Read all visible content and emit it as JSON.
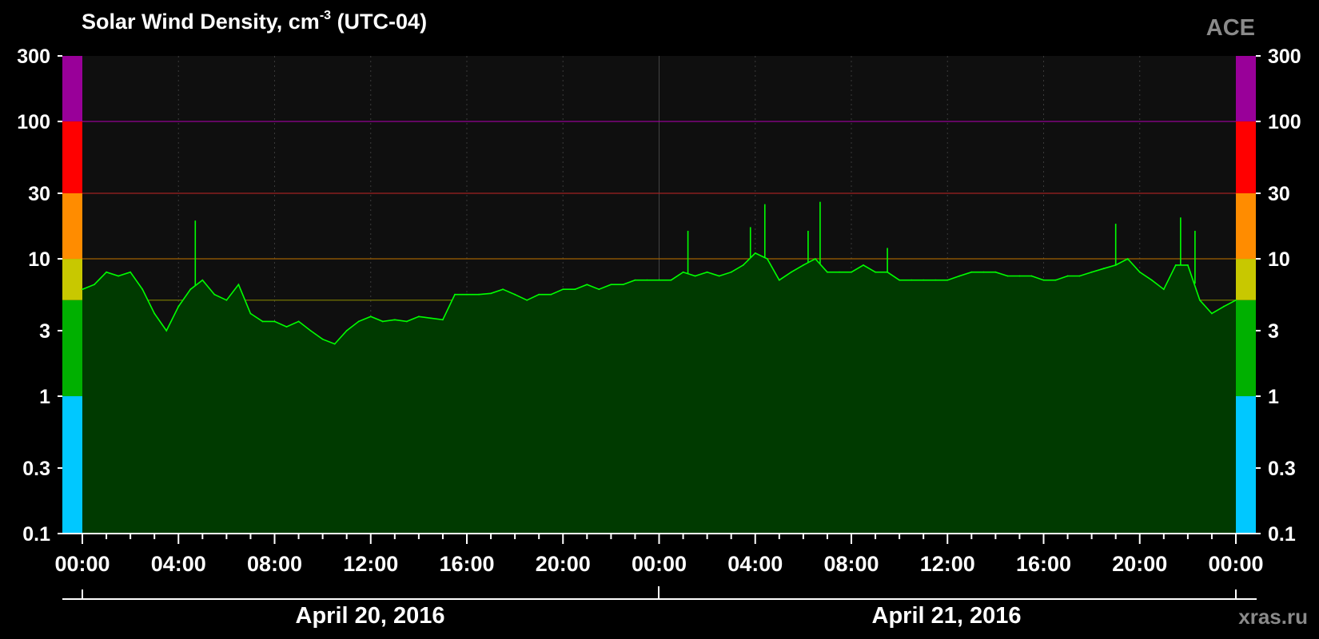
{
  "title": {
    "text": "Solar Wind Density, cm",
    "superscript": "-3",
    "suffix": " (UTC-04)"
  },
  "source_label": "ACE",
  "watermark": "xras.ru",
  "colors": {
    "line": "#00ff00",
    "fill": "#003a00",
    "plot_bg": "#0f0f0f",
    "band_purple": "#990099",
    "band_red": "#ff0000",
    "band_orange": "#ff8c00",
    "band_yellow": "#c8c800",
    "band_green": "#00b000",
    "band_cyan": "#00c8ff"
  },
  "chart_data": {
    "type": "area",
    "yscale": "log",
    "ylim": [
      0.1,
      300
    ],
    "y_ticks": [
      "0.1",
      "0.3",
      "1",
      "3",
      "10",
      "30",
      "100",
      "300"
    ],
    "x_range_hours": [
      0,
      48
    ],
    "x_tick_labels": [
      "00:00",
      "04:00",
      "08:00",
      "12:00",
      "16:00",
      "20:00",
      "00:00",
      "04:00",
      "08:00",
      "12:00",
      "16:00",
      "20:00",
      "00:00"
    ],
    "date_labels": [
      "April 20, 2016",
      "April 21, 2016"
    ],
    "threshold_lines": [
      {
        "value": 100,
        "color": "#a000a0"
      },
      {
        "value": 30,
        "color": "#a02020"
      },
      {
        "value": 10,
        "color": "#a06000"
      },
      {
        "value": 5,
        "color": "#808000"
      }
    ],
    "color_bands": [
      {
        "from": 100,
        "to": 300,
        "color": "#990099"
      },
      {
        "from": 30,
        "to": 100,
        "color": "#ff0000"
      },
      {
        "from": 10,
        "to": 30,
        "color": "#ff8c00"
      },
      {
        "from": 5,
        "to": 10,
        "color": "#c8c800"
      },
      {
        "from": 1,
        "to": 5,
        "color": "#00b000"
      },
      {
        "from": 0.1,
        "to": 1,
        "color": "#00c8ff"
      }
    ],
    "series": [
      {
        "x": [
          0,
          0.5,
          1,
          1.5,
          2,
          2.5,
          3,
          3.5,
          4,
          4.5,
          5,
          5.5,
          6,
          6.5,
          7,
          7.5,
          8,
          8.5,
          9,
          9.5,
          10,
          10.5,
          11,
          11.5,
          12,
          12.5,
          13,
          13.5,
          14,
          14.5,
          15,
          15.5,
          16,
          16.5,
          17,
          17.5,
          18,
          18.5,
          19,
          19.5,
          20,
          20.5,
          21,
          21.5,
          22,
          22.5,
          23,
          23.5,
          24,
          24.5,
          25,
          25.5,
          26,
          26.5,
          27,
          27.5,
          28,
          28.5,
          29,
          29.5,
          30,
          30.5,
          31,
          31.5,
          32,
          32.5,
          33,
          33.5,
          34,
          34.5,
          35,
          35.5,
          36,
          36.5,
          37,
          37.5,
          38,
          38.5,
          39,
          39.5,
          40,
          40.5,
          41,
          41.5,
          42,
          42.5,
          43,
          43.5,
          44,
          44.5,
          45,
          45.5,
          46,
          46.5,
          47,
          47.5,
          48
        ],
        "values": [
          6,
          6.5,
          8,
          7.5,
          8,
          6,
          4,
          3,
          4.5,
          6,
          7,
          5.5,
          5,
          6.5,
          4,
          3.5,
          3.5,
          3.2,
          3.5,
          3,
          2.6,
          2.4,
          3,
          3.5,
          3.8,
          3.5,
          3.6,
          3.5,
          3.8,
          3.7,
          3.6,
          5.5,
          5.5,
          5.5,
          5.6,
          6,
          5.5,
          5,
          5.5,
          5.5,
          6,
          6,
          6.5,
          6,
          6.5,
          6.5,
          7,
          7,
          7,
          7,
          8,
          7.5,
          8,
          7.5,
          8,
          9,
          11,
          10,
          7,
          8,
          9,
          10,
          8,
          8,
          8,
          9,
          8,
          8,
          7,
          7,
          7,
          7,
          7,
          7.5,
          8,
          8,
          8,
          7.5,
          7.5,
          7.5,
          7,
          7,
          7.5,
          7.5,
          8,
          8.5,
          9,
          10,
          8,
          7,
          6,
          9,
          9,
          5,
          4,
          4.5,
          5
        ]
      }
    ],
    "spikes": [
      {
        "x": 4.7,
        "value": 19
      },
      {
        "x": 25.2,
        "value": 16
      },
      {
        "x": 27.8,
        "value": 17
      },
      {
        "x": 28.4,
        "value": 25
      },
      {
        "x": 30.7,
        "value": 26
      },
      {
        "x": 30.2,
        "value": 16
      },
      {
        "x": 33.5,
        "value": 12
      },
      {
        "x": 43,
        "value": 18
      },
      {
        "x": 45.7,
        "value": 20
      },
      {
        "x": 46.3,
        "value": 16
      }
    ]
  }
}
